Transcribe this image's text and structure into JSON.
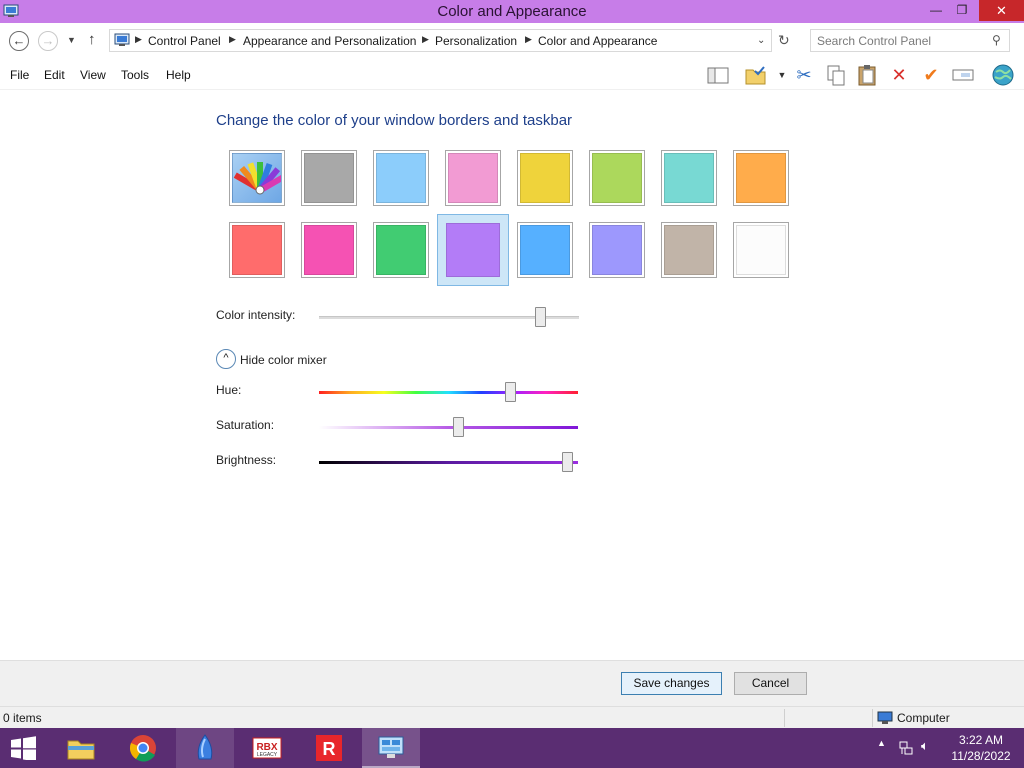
{
  "window": {
    "title": "Color and Appearance",
    "minimize_label": "—",
    "maximize_label": "❐",
    "close_label": "✕"
  },
  "address": {
    "breadcrumbs": [
      "Control Panel",
      "Appearance and Personalization",
      "Personalization",
      "Color and Appearance"
    ],
    "search_placeholder": "Search Control Panel"
  },
  "menu": {
    "items": [
      "File",
      "Edit",
      "View",
      "Tools",
      "Help"
    ]
  },
  "toolbar": {
    "tools": [
      "layout-icon",
      "folder-check-icon",
      "cut-icon",
      "copy-icon",
      "paste-icon",
      "delete-icon",
      "checkmark-icon",
      "rename-icon",
      "globe-icon"
    ]
  },
  "main": {
    "heading": "Change the color of your window borders and taskbar",
    "swatches": [
      {
        "name": "custom",
        "color": "#8fc0f0"
      },
      {
        "name": "gray",
        "color": "#a8a8a8"
      },
      {
        "name": "light-blue",
        "color": "#8ccdfb"
      },
      {
        "name": "pink",
        "color": "#f29bd3"
      },
      {
        "name": "yellow",
        "color": "#efd33b"
      },
      {
        "name": "lime",
        "color": "#acd85c"
      },
      {
        "name": "teal",
        "color": "#78d9d3"
      },
      {
        "name": "orange",
        "color": "#ffac4b"
      },
      {
        "name": "red",
        "color": "#ff6c6c"
      },
      {
        "name": "magenta",
        "color": "#f552b3"
      },
      {
        "name": "green",
        "color": "#41cc72"
      },
      {
        "name": "purple",
        "color": "#b37cf7"
      },
      {
        "name": "blue",
        "color": "#56b0ff"
      },
      {
        "name": "lavender",
        "color": "#9d98fd"
      },
      {
        "name": "taupe",
        "color": "#c1b4a8"
      },
      {
        "name": "white",
        "color": "#fcfcfc"
      }
    ],
    "selected_swatch": "purple",
    "intensity_label": "Color intensity:",
    "intensity_value": 0.87,
    "mixer_toggle_label": "Hide color mixer",
    "hue_label": "Hue:",
    "hue_value": 0.75,
    "saturation_label": "Saturation:",
    "saturation_value": 0.54,
    "brightness_label": "Brightness:",
    "brightness_value": 0.98
  },
  "buttons": {
    "save": "Save changes",
    "cancel": "Cancel"
  },
  "status": {
    "items_count": "0 items",
    "location": "Computer"
  },
  "taskbar": {
    "apps": [
      "file-explorer",
      "chrome",
      "blue-crystal-app",
      "rbx-legacy",
      "roblox",
      "control-panel"
    ],
    "active_app": "control-panel",
    "time": "3:22 AM",
    "date": "11/28/2022",
    "accent": "#5a2d72"
  }
}
